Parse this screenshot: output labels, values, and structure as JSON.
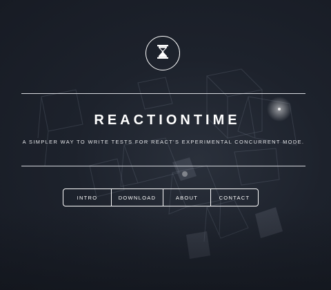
{
  "header": {
    "title": "REACTIONTIME",
    "tagline": "A SIMPLER WAY TO WRITE TESTS FOR REACT'S EXPERIMENTAL CONCURRENT MODE."
  },
  "logo": {
    "icon": "hourglass-icon"
  },
  "nav": {
    "items": [
      {
        "label": "INTRO"
      },
      {
        "label": "DOWNLOAD"
      },
      {
        "label": "ABOUT"
      },
      {
        "label": "CONTACT"
      }
    ]
  },
  "colors": {
    "background": "#1b1f2a",
    "foreground": "#ffffff",
    "rule": "#d9dbe0"
  }
}
